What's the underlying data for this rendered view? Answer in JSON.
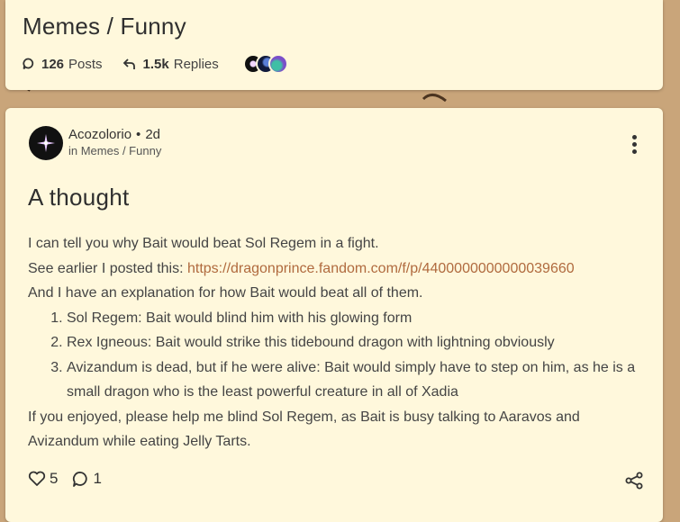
{
  "header": {
    "title": "Memes / Funny",
    "posts_count": "126",
    "posts_label": "Posts",
    "replies_count": "1.5k",
    "replies_label": "Replies"
  },
  "post": {
    "author": "Acozolorio",
    "separator": "•",
    "time": "2d",
    "location": "in Memes / Funny",
    "title": "A thought",
    "body": {
      "line1": "I can tell you why Bait would beat Sol Regem in a fight.",
      "line2_prefix": "See earlier I posted this: ",
      "link": "https://dragonprince.fandom.com/f/p/4400000000000039660",
      "line3": "And I have an explanation for how Bait would beat all of them.",
      "list": [
        "Sol Regem: Bait would blind him with his glowing form",
        "Rex Igneous: Bait would strike this tidebound dragon with lightning obviously",
        "Avizandum is dead, but if he were alive: Bait would simply have to step on him, as he is a small dragon who is the least powerful creature in all of Xadia"
      ],
      "closing": "If you enjoyed, please help me blind Sol Regem, as Bait is busy talking to Aaravos and Avizandum while eating Jelly Tarts."
    },
    "likes": "5",
    "replies": "1"
  },
  "icons": {
    "posts": "speech-bubble-icon",
    "replies": "reply-arrow-icon",
    "more": "vertical-dots-icon",
    "like": "heart-icon",
    "reply": "comment-icon",
    "share": "share-icon"
  }
}
